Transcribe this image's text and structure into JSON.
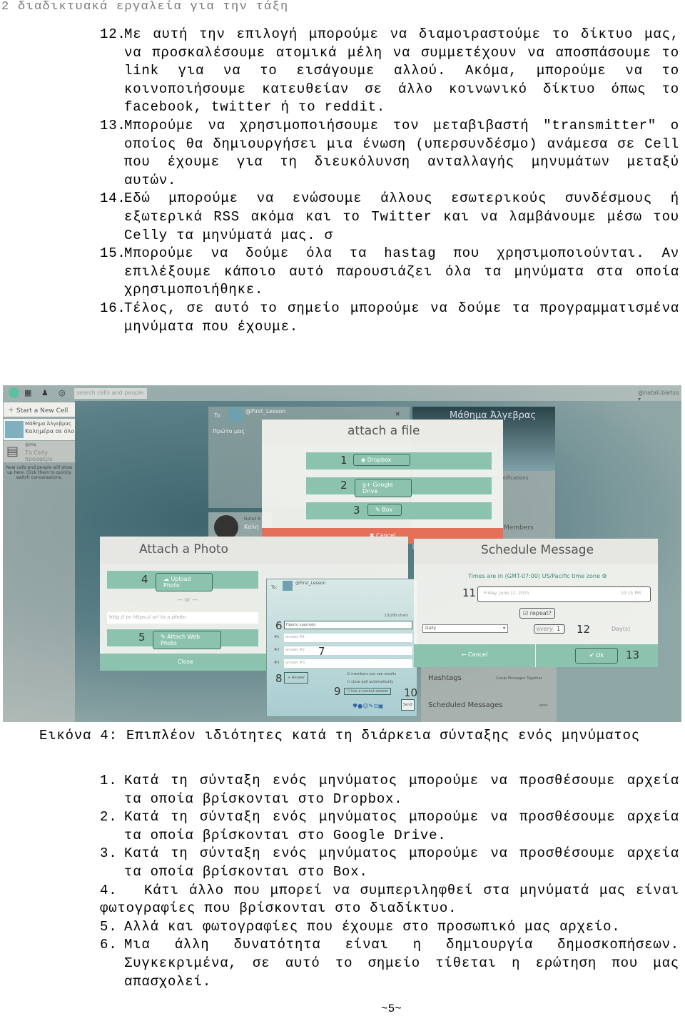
{
  "header": "2 διαδικτυακά εργαλεία για την τάξη",
  "top_list": [
    {
      "n": "12.",
      "text": "Με αυτή την επιλογή μπορούμε να διαμοιραστούμε το δίκτυο μας, να προσκαλέσουμε ατομικά μέλη να συμμετέχουν να αποσπάσουμε το link για να το εισάγουμε αλλού. Ακόμα, μπορούμε να το κοινοποιήσουμε κατευθείαν σε άλλο κοινωνικό δίκτυο όπως το facebook, twitter ή το reddit."
    },
    {
      "n": "13.",
      "text": "Μπορούμε να χρησιμοποιήσουμε τον μεταβιβαστή \"transmitter\" ο οποίος θα δημιουργήσει μια ένωση (υπερσυνδέσμο) ανάμεσα σε Cell που έχουμε για τη διευκόλυνση ανταλλαγής μηνυμάτων μεταξύ αυτών."
    },
    {
      "n": "14.",
      "text": "Εδώ μπορούμε να ενώσουμε άλλους εσωτερικούς συνδέσμους ή εξωτερικά RSS ακόμα και το Twitter και να λαμβάνουμε μέσω του Celly τα μηνύματά μας. σ"
    },
    {
      "n": "15.",
      "text": "Μπορούμε να δούμε όλα τα hastag που χρησιμοποιούνται. Αν επιλέξουμε κάποιο αυτό παρουσιάζει όλα τα μηνύματα στα οποία χρησιμοποιήθηκε."
    },
    {
      "n": "16.",
      "text": "Τέλος, σε αυτό το σημείο μπορούμε να δούμε τα προγραμματισμένα μηνύματα που έχουμε."
    }
  ],
  "screenshot": {
    "search_placeholder": "search cells and people",
    "user": "@natali.bletso ▾",
    "start_cell": "Start a New Cell",
    "cell1_title": "Μάθημα Άλγεβρας",
    "cell1_msg": "Καλημέρα σε όλο",
    "cell2_title": "@me",
    "cell2_msg": "Το Celly προσφέρε",
    "hint": "New cells and people will show up here. Click them to quickly switch conversations.",
    "to": "To:",
    "to_cell": "@First_Lesson",
    "msg_draft": "Πρώτο μας",
    "attach_file": {
      "title": "attach a file",
      "dropbox": "Dropbox",
      "gdrive": "Google Drive",
      "box": "Box",
      "cancel": "✖ Cancel"
    },
    "cell_panel": {
      "title": "Μάθημα Άλγεβρας",
      "notifications": "Notifications",
      "members": "Members",
      "poster": "Natali B",
      "poster_msg": "Καλη"
    },
    "attach_photo": {
      "title": "Attach a Photo",
      "upload": "Upload Photo",
      "or": "— or —",
      "url_placeholder": "http:// or https:// url to a photo",
      "attach_web": "Attach Web Photo",
      "close": "Close"
    },
    "poll": {
      "to": "To:",
      "cell": "@First_Lesson",
      "chars": "13/200 chars",
      "question": "Πρώτη ερώτηση",
      "answers": [
        "answer #1",
        "answer #2",
        "answer #3"
      ],
      "answer_labels": [
        "#1",
        "#2",
        "#3"
      ],
      "add_answer": "+ Answer",
      "opt1": "members can see results",
      "opt2": "close poll automatically",
      "opt3": "has a correct answer",
      "send": "Send"
    },
    "schedule": {
      "title": "Schedule Message",
      "tz": "Times are in (GMT-07:00) US/Pacific time zone",
      "date": "Friday, June 12, 2015",
      "time": "10:15 PM",
      "repeat": "repeat?",
      "freq": "Daily",
      "every": "every",
      "every_n": "1",
      "unit": "Day(s)",
      "cancel": "← Cancel",
      "ok": "✔ Ok"
    },
    "hashtags": "Hashtags",
    "hashtags_desc": "Group Messages Together",
    "scheduled": "Scheduled Messages",
    "scheduled_desc": "none",
    "markers": [
      "1",
      "2",
      "3",
      "4",
      "5",
      "6",
      "7",
      "8",
      "9",
      "10",
      "11",
      "12",
      "13"
    ]
  },
  "caption": "Εικόνα 4: Επιπλέον ιδιότητες κατά τη διάρκεια σύνταξης ενός μηνύματος",
  "bottom_list": [
    {
      "n": "1.",
      "text": "Κατά τη σύνταξη ενός μηνύματος μπορούμε να προσθέσουμε αρχεία τα οποία βρίσκονται στο Dropbox."
    },
    {
      "n": "2.",
      "text": "Κατά τη σύνταξη ενός μηνύματος μπορούμε να προσθέσουμε αρχεία τα οποία βρίσκονται στο Google Drive."
    },
    {
      "n": "3.",
      "text": "Κατά τη σύνταξη ενός μηνύματος μπορούμε να προσθέσουμε αρχεία τα οποία βρίσκονται στο Box."
    },
    {
      "n": "4.",
      "text": "Κάτι άλλο που μπορεί να συμπεριληφθεί στα μηνύματά μας είναι φωτογραφίες που βρίσκονται στο διαδίκτυο."
    },
    {
      "n": "5.",
      "text": "Αλλά και φωτογραφίες που έχουμε στο προσωπικό μας αρχείο."
    },
    {
      "n": "6.",
      "text": "Μια άλλη δυνατότητα είναι η δημιουργία δημοσκοπήσεων. Συγκεκριμένα, σε αυτό το σημείο τίθεται η ερώτηση που μας απασχολεί."
    }
  ],
  "page_number": "~5~"
}
